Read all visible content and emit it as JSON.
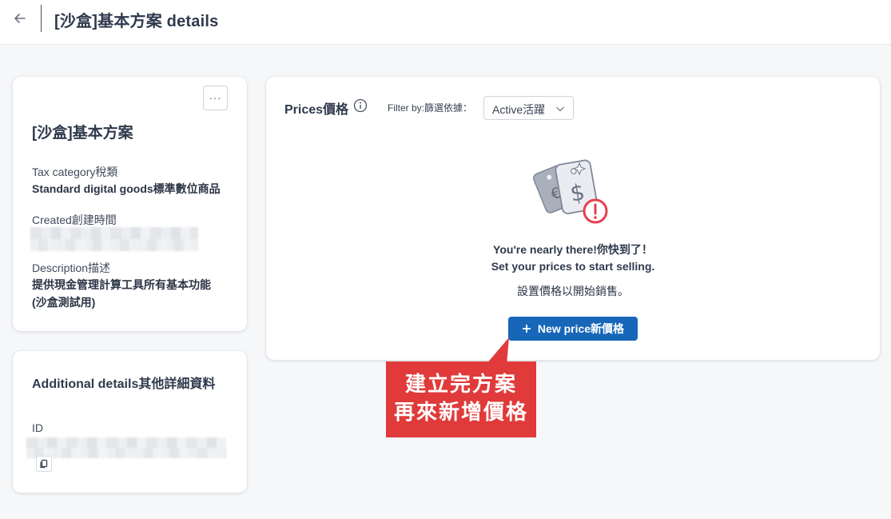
{
  "header": {
    "title": "[沙盒]基本方案 details"
  },
  "product_card": {
    "name": "[沙盒]基本方案",
    "more_label": "···",
    "tax_category_label": "Tax category稅類",
    "tax_category_value": "Standard digital goods標準數位商品",
    "created_label": "Created創建時間",
    "description_label": "Description描述",
    "description_value_line1": "提供現金管理計算工具所有基本功能",
    "description_value_line2": "(沙盒測試用)"
  },
  "additional_card": {
    "title": "Additional details其他詳細資料",
    "id_label": "ID"
  },
  "prices_card": {
    "title": "Prices價格",
    "filter_label": "Filter by:篩選依據：",
    "filter_value": "Active活躍",
    "empty_line1": "You're nearly there!你快到了！",
    "empty_line2": "Set your prices to start selling.",
    "empty_line3": "設置價格以開始銷售。",
    "new_price_label": "New price新價格"
  },
  "callout": {
    "line1": "建立完方案",
    "line2": "再來新增價格"
  },
  "colors": {
    "primary_button": "#1766b8",
    "callout": "#e03a3a",
    "alert": "#e5404f"
  },
  "icons": [
    "back-arrow-icon",
    "more-icon",
    "copy-icon",
    "info-icon",
    "chevron-down-icon",
    "price-tag-icon",
    "alert-icon",
    "plus-icon"
  ]
}
